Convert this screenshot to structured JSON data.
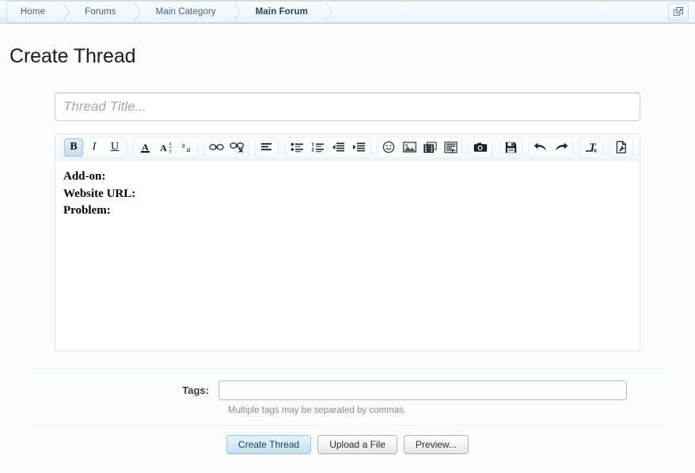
{
  "breadcrumb": {
    "items": [
      {
        "label": "Home",
        "current": false
      },
      {
        "label": "Forums",
        "current": false
      },
      {
        "label": "Main Category",
        "current": false
      },
      {
        "label": "Main Forum",
        "current": true
      }
    ],
    "popup_button_title": "Open in popup"
  },
  "page": {
    "title": "Create Thread"
  },
  "thread_title": {
    "value": "",
    "placeholder": "Thread Title..."
  },
  "editor": {
    "toolbar": {
      "groups": [
        {
          "name": "inline-style",
          "buttons": [
            {
              "name": "bold-icon",
              "label": "B",
              "kind": "bold",
              "active": true,
              "title": "Bold"
            },
            {
              "name": "italic-icon",
              "label": "I",
              "kind": "italic",
              "active": false,
              "title": "Italic"
            },
            {
              "name": "underline-icon",
              "label": "U",
              "kind": "underline",
              "active": false,
              "title": "Underline"
            }
          ]
        },
        {
          "name": "font-style",
          "buttons": [
            {
              "name": "text-color-icon",
              "label": "A",
              "kind": "color",
              "active": false,
              "title": "Text Color"
            },
            {
              "name": "font-size-icon",
              "label": "A",
              "kind": "fontsize",
              "active": false,
              "title": "Font Size"
            },
            {
              "name": "font-family-icon",
              "label": "a",
              "kind": "fontfamily",
              "active": false,
              "title": "Font Family"
            }
          ]
        },
        {
          "name": "links",
          "buttons": [
            {
              "name": "insert-link-icon",
              "label": "",
              "kind": "link",
              "active": false,
              "title": "Insert Link"
            },
            {
              "name": "unlink-icon",
              "label": "",
              "kind": "unlink",
              "active": false,
              "title": "Unlink"
            }
          ]
        },
        {
          "name": "alignment",
          "buttons": [
            {
              "name": "align-icon",
              "label": "",
              "kind": "align",
              "active": false,
              "title": "Alignment"
            }
          ]
        },
        {
          "name": "lists",
          "buttons": [
            {
              "name": "bullet-list-icon",
              "label": "",
              "kind": "ul",
              "active": false,
              "title": "Bullet List"
            },
            {
              "name": "numbered-list-icon",
              "label": "",
              "kind": "ol",
              "active": false,
              "title": "Numbered List"
            },
            {
              "name": "outdent-icon",
              "label": "",
              "kind": "outdent",
              "active": false,
              "title": "Outdent"
            },
            {
              "name": "indent-icon",
              "label": "",
              "kind": "indent",
              "active": false,
              "title": "Indent"
            }
          ]
        },
        {
          "name": "media",
          "buttons": [
            {
              "name": "smilie-icon",
              "label": "",
              "kind": "smilie",
              "active": false,
              "title": "Smilies"
            },
            {
              "name": "insert-image-icon",
              "label": "",
              "kind": "image",
              "active": false,
              "title": "Insert Image"
            },
            {
              "name": "insert-media-icon",
              "label": "",
              "kind": "film",
              "active": false,
              "title": "Media"
            },
            {
              "name": "insert-quote-icon",
              "label": "",
              "kind": "quote",
              "active": false,
              "title": "Insert Quote"
            }
          ]
        },
        {
          "name": "capture",
          "buttons": [
            {
              "name": "camera-icon",
              "label": "",
              "kind": "camera",
              "active": false,
              "title": "Screenshot"
            }
          ]
        },
        {
          "name": "draft",
          "buttons": [
            {
              "name": "save-draft-icon",
              "label": "",
              "kind": "floppy",
              "active": false,
              "title": "Save Draft"
            }
          ]
        },
        {
          "name": "history",
          "buttons": [
            {
              "name": "undo-icon",
              "label": "",
              "kind": "undo",
              "active": false,
              "title": "Undo"
            },
            {
              "name": "redo-icon",
              "label": "",
              "kind": "redo",
              "active": false,
              "title": "Redo"
            }
          ]
        },
        {
          "name": "cleanup",
          "buttons": [
            {
              "name": "remove-formatting-icon",
              "label": "",
              "kind": "removeformat",
              "active": false,
              "title": "Remove Formatting"
            }
          ]
        },
        {
          "name": "source",
          "buttons": [
            {
              "name": "toggle-bbcode-icon",
              "label": "",
              "kind": "bbcode",
              "active": false,
              "title": "Toggle BB Code"
            }
          ]
        }
      ]
    },
    "content_lines": [
      "Add-on:",
      "Website URL:",
      "Problem:"
    ]
  },
  "tags": {
    "label": "Tags:",
    "value": "",
    "placeholder": "",
    "hint": "Multiple tags may be separated by commas."
  },
  "actions": {
    "submit_label": "Create Thread",
    "upload_label": "Upload a File",
    "preview_label": "Preview..."
  },
  "colors": {
    "accent": "#3b5e7e",
    "crumb_border": "#c6dced",
    "rule": "#dff0fa",
    "primary_button": "#c3dff2"
  }
}
